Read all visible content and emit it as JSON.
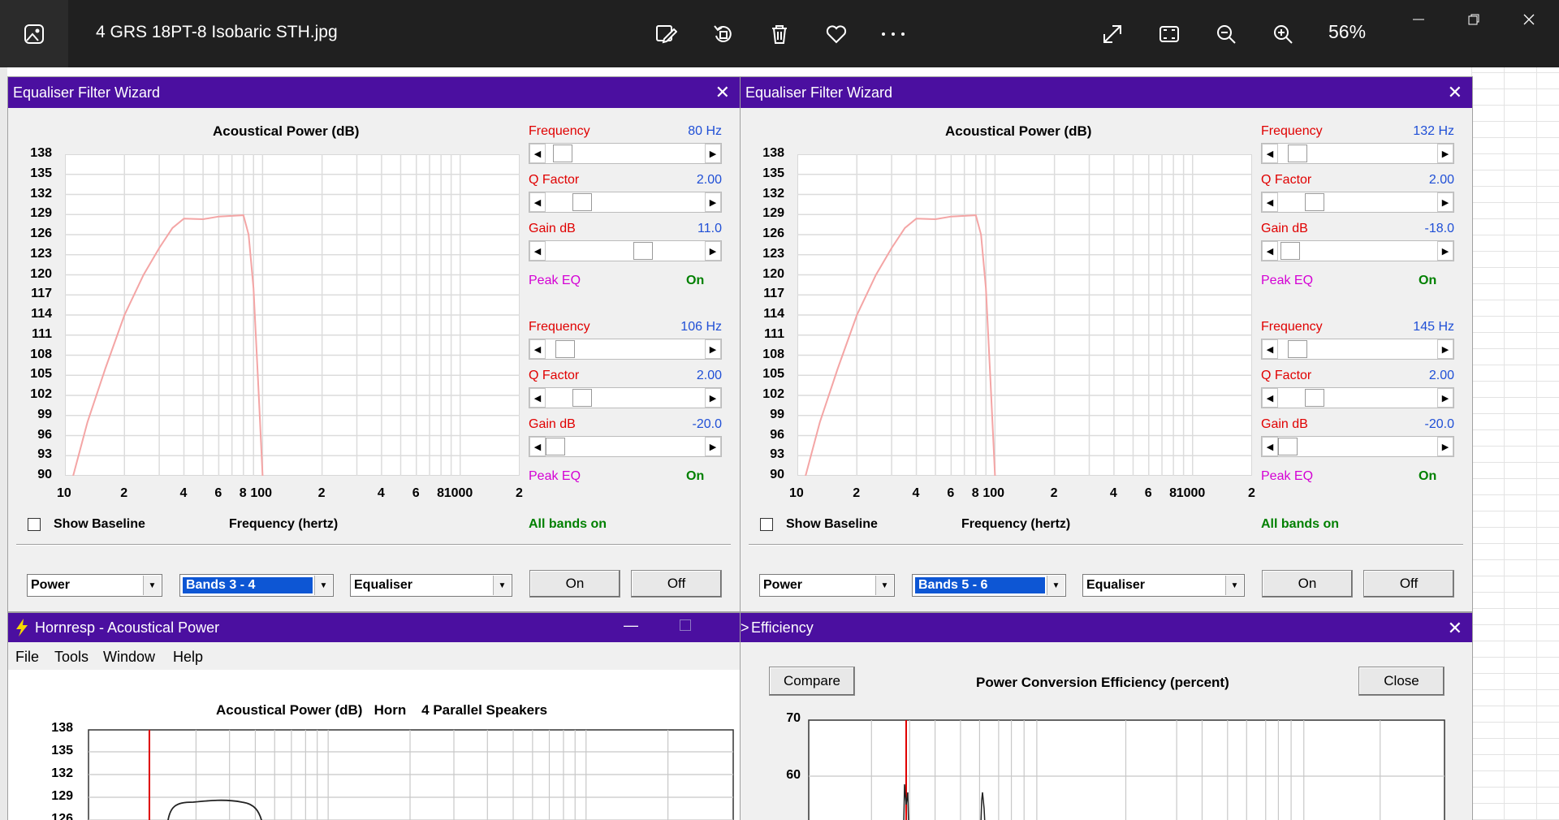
{
  "viewer": {
    "file_name": "4 GRS 18PT-8 Isobaric STH.jpg",
    "zoom": "56%",
    "icons": [
      "edit-icon",
      "rotate-icon",
      "delete-icon",
      "favorite-icon",
      "more-icon",
      "expand-icon",
      "fit-icon",
      "zoom-out-icon",
      "zoom-in-icon"
    ]
  },
  "eq_left": {
    "title": "Equaliser Filter Wizard",
    "chart_title": "Acoustical Power (dB)",
    "y_ticks": [
      "138",
      "135",
      "132",
      "129",
      "126",
      "123",
      "120",
      "117",
      "114",
      "111",
      "108",
      "105",
      "102",
      "99",
      "96",
      "93",
      "90"
    ],
    "x_ticks": [
      "10",
      "2",
      "4",
      "6",
      "8",
      "100",
      "2",
      "4",
      "6",
      "8",
      "1000",
      "2"
    ],
    "x_label": "Frequency (hertz)",
    "show_baseline": "Show Baseline",
    "all_bands": "All bands on",
    "bands": [
      {
        "freq_label": "Frequency",
        "freq_value": "80 Hz",
        "q_label": "Q Factor",
        "q_value": "2.00",
        "gain_label": "Gain  dB",
        "gain_value": "11.0",
        "type": "Peak EQ",
        "state": "On",
        "freq_pos": 0.05,
        "q_pos": 0.19,
        "gain_pos": 0.62
      },
      {
        "freq_label": "Frequency",
        "freq_value": "106 Hz",
        "q_label": "Q Factor",
        "q_value": "2.00",
        "gain_label": "Gain  dB",
        "gain_value": "-20.0",
        "type": "Peak EQ",
        "state": "On",
        "freq_pos": 0.07,
        "q_pos": 0.19,
        "gain_pos": 0.0
      }
    ],
    "combo1": "Power",
    "combo2": "Bands 3 - 4",
    "combo3": "Equaliser",
    "btn_on": "On",
    "btn_off": "Off"
  },
  "eq_right": {
    "title": "Equaliser Filter Wizard",
    "chart_title": "Acoustical Power (dB)",
    "y_ticks": [
      "138",
      "135",
      "132",
      "129",
      "126",
      "123",
      "120",
      "117",
      "114",
      "111",
      "108",
      "105",
      "102",
      "99",
      "96",
      "93",
      "90"
    ],
    "x_ticks": [
      "10",
      "2",
      "4",
      "6",
      "8",
      "100",
      "2",
      "4",
      "6",
      "8",
      "1000",
      "2"
    ],
    "x_label": "Frequency (hertz)",
    "show_baseline": "Show Baseline",
    "all_bands": "All bands on",
    "bands": [
      {
        "freq_label": "Frequency",
        "freq_value": "132 Hz",
        "q_label": "Q Factor",
        "q_value": "2.00",
        "gain_label": "Gain  dB",
        "gain_value": "-18.0",
        "type": "Peak EQ",
        "state": "On",
        "freq_pos": 0.07,
        "q_pos": 0.19,
        "gain_pos": 0.02
      },
      {
        "freq_label": "Frequency",
        "freq_value": "145 Hz",
        "q_label": "Q Factor",
        "q_value": "2.00",
        "gain_label": "Gain  dB",
        "gain_value": "-20.0",
        "type": "Peak EQ",
        "state": "On",
        "freq_pos": 0.07,
        "q_pos": 0.19,
        "gain_pos": 0.0
      }
    ],
    "combo1": "Power",
    "combo2": "Bands 5 - 6",
    "combo3": "Equaliser",
    "btn_on": "On",
    "btn_off": "Off"
  },
  "hornresp": {
    "title": "Hornresp - Acoustical Power",
    "menu": [
      "File",
      "Tools",
      "Window",
      "Help"
    ],
    "chart_title": "Acoustical Power (dB)   Horn    4 Parallel Speakers",
    "y_ticks": [
      "138",
      "135",
      "132",
      "129",
      "126"
    ]
  },
  "efficiency": {
    "title": "Efficiency",
    "compare": "Compare",
    "chart_title": "Power Conversion Efficiency (percent)",
    "close": "Close",
    "y_ticks": [
      "70",
      "60"
    ]
  },
  "chart_data": {
    "type": "line",
    "title": "Acoustical Power (dB)",
    "xlabel": "Frequency (hertz)",
    "ylabel": "",
    "ylim": [
      90,
      138
    ],
    "xlim": [
      10,
      2000
    ],
    "x_scale": "log",
    "series": [
      {
        "x": [
          11,
          13,
          16,
          20,
          25,
          30,
          35,
          40,
          50,
          60,
          70,
          80,
          85,
          90,
          95,
          100
        ],
        "y": [
          90,
          98,
          106,
          114,
          120,
          124,
          127,
          128.4,
          128.3,
          128.7,
          128.8,
          128.9,
          126,
          118,
          104,
          90
        ]
      }
    ]
  }
}
